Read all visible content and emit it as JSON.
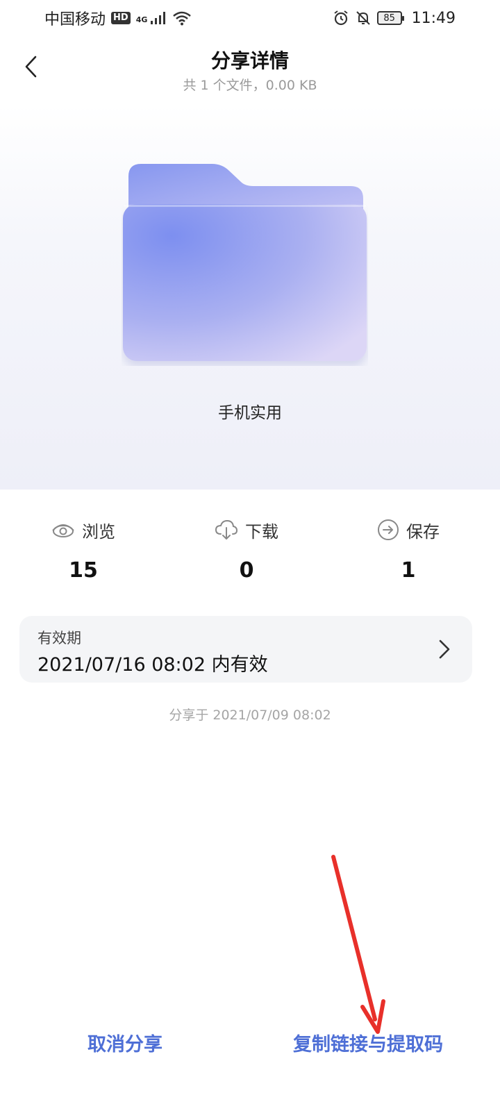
{
  "status_bar": {
    "carrier": "中国移动",
    "hd": "HD",
    "network": "4G",
    "battery": "85",
    "time": "11:49"
  },
  "header": {
    "title": "分享详情",
    "subtitle": "共 1 个文件，0.00 KB"
  },
  "file": {
    "name": "手机实用"
  },
  "stats": {
    "views_label": "浏览",
    "views_value": "15",
    "downloads_label": "下载",
    "downloads_value": "0",
    "saves_label": "保存",
    "saves_value": "1"
  },
  "validity": {
    "label": "有效期",
    "value": "2021/07/16 08:02 内有效"
  },
  "shared_at": "分享于 2021/07/09 08:02",
  "actions": {
    "cancel_label": "取消分享",
    "copy_label": "复制链接与提取码"
  },
  "colors": {
    "accent": "#4e6fd6",
    "folder": "#8e99ef",
    "annotation": "#e8302a"
  }
}
